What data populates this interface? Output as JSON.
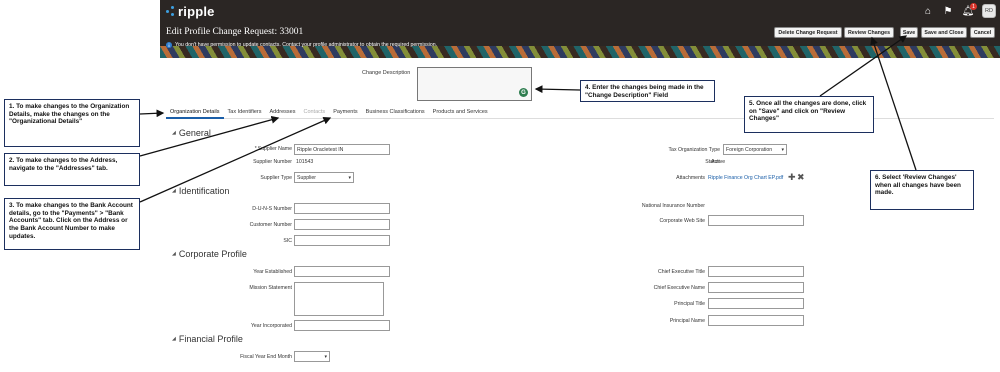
{
  "app": {
    "logo_text": "ripple"
  },
  "topbar": {
    "notification_count": "1",
    "avatar_initials": "RD"
  },
  "header": {
    "title": "Edit Profile Change Request: 33001",
    "message": "You don't have permission to update contacts. Contact your profile administrator to obtain the required permission.",
    "buttons": {
      "delete": "Delete Change Request",
      "review": "Review Changes",
      "save": "Save",
      "save_close": "Save and Close",
      "cancel": "Cancel"
    }
  },
  "change_description": {
    "label": "Change Description"
  },
  "tabs": [
    "Organization Details",
    "Tax Identifiers",
    "Addresses",
    "Contacts",
    "Payments",
    "Business Classifications",
    "Products and Services"
  ],
  "sections": {
    "general": "General",
    "identification": "Identification",
    "corporate": "Corporate Profile",
    "financial": "Financial Profile"
  },
  "general": {
    "supplier_name_label": "Supplier Name",
    "supplier_name_value": "Ripple Oracletest IN",
    "supplier_number_label": "Supplier Number",
    "supplier_number_value": "101543",
    "supplier_type_label": "Supplier Type",
    "supplier_type_value": "Supplier",
    "tax_org_type_label": "Tax Organization Type",
    "tax_org_type_value": "Foreign Corporation",
    "status_label": "Status",
    "status_value": "Active",
    "attachments_label": "Attachments",
    "attachments_value": "Ripple Finance Org Chart EP.pdf"
  },
  "identification": {
    "duns_label": "D-U-N-S Number",
    "customer_number_label": "Customer Number",
    "sic_label": "SIC",
    "national_insurance_label": "National Insurance Number",
    "corporate_web_site_label": "Corporate Web Site"
  },
  "corporate": {
    "year_established_label": "Year Established",
    "mission_statement_label": "Mission Statement",
    "year_incorporated_label": "Year Incorporated",
    "ceo_title_label": "Chief Executive Title",
    "ceo_name_label": "Chief Executive Name",
    "principal_title_label": "Principal Title",
    "principal_name_label": "Principal Name"
  },
  "financial": {
    "fiscal_year_end_label": "Fiscal Year End Month"
  },
  "callouts": {
    "c1": "1. To make changes to the Organization Details, make the changes on the \"Organizational Details\"",
    "c2": "2. To make changes to the Address, navigate to the \"Addresses\" tab.",
    "c3": "3. To make changes to the Bank Account details, go to the \"Payments\" > \"Bank Accounts\" tab. Click on the Address or the Bank Account Number to make updates.",
    "c4": "4. Enter the changes being made in the \"Change Description\" Field",
    "c5": "5. Once all the changes are done, click on \"Save\" and click on \"Review Changes\"",
    "c6": "6. Select 'Review Changes' when all changes have been made."
  },
  "colors": {
    "topbar": "#2b2624",
    "accent": "#1a5ea8",
    "callout_border": "#1c2f5e"
  }
}
